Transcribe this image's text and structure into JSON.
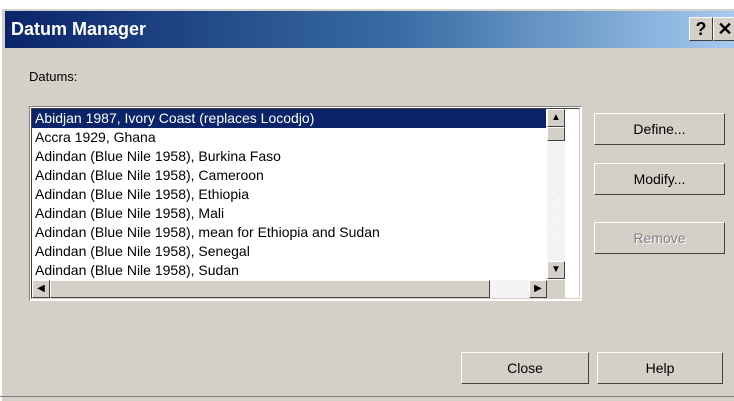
{
  "window": {
    "title": "Datum Manager",
    "help_glyph": "?",
    "close_glyph": "✕"
  },
  "datums_label": "Datums:",
  "datums": [
    {
      "label": "Abidjan 1987, Ivory Coast (replaces Locodjo)",
      "selected": true
    },
    {
      "label": "Accra 1929, Ghana",
      "selected": false
    },
    {
      "label": "Adindan (Blue Nile 1958), Burkina Faso",
      "selected": false
    },
    {
      "label": "Adindan (Blue Nile 1958), Cameroon",
      "selected": false
    },
    {
      "label": "Adindan (Blue Nile 1958), Ethiopia",
      "selected": false
    },
    {
      "label": "Adindan (Blue Nile 1958), Mali",
      "selected": false
    },
    {
      "label": "Adindan (Blue Nile 1958), mean for Ethiopia and Sudan",
      "selected": false
    },
    {
      "label": "Adindan (Blue Nile 1958), Senegal",
      "selected": false
    },
    {
      "label": "Adindan (Blue Nile 1958), Sudan",
      "selected": false
    }
  ],
  "scroll": {
    "up": "▲",
    "down": "▼",
    "left": "◀",
    "right": "▶"
  },
  "buttons": {
    "define": "Define...",
    "modify": "Modify...",
    "remove": "Remove",
    "close": "Close",
    "help": "Help"
  },
  "colors": {
    "dialog_bg": "#d4d0c8",
    "selection": "#0a246a",
    "title_start": "#0a246a",
    "title_end": "#a6caf0"
  }
}
